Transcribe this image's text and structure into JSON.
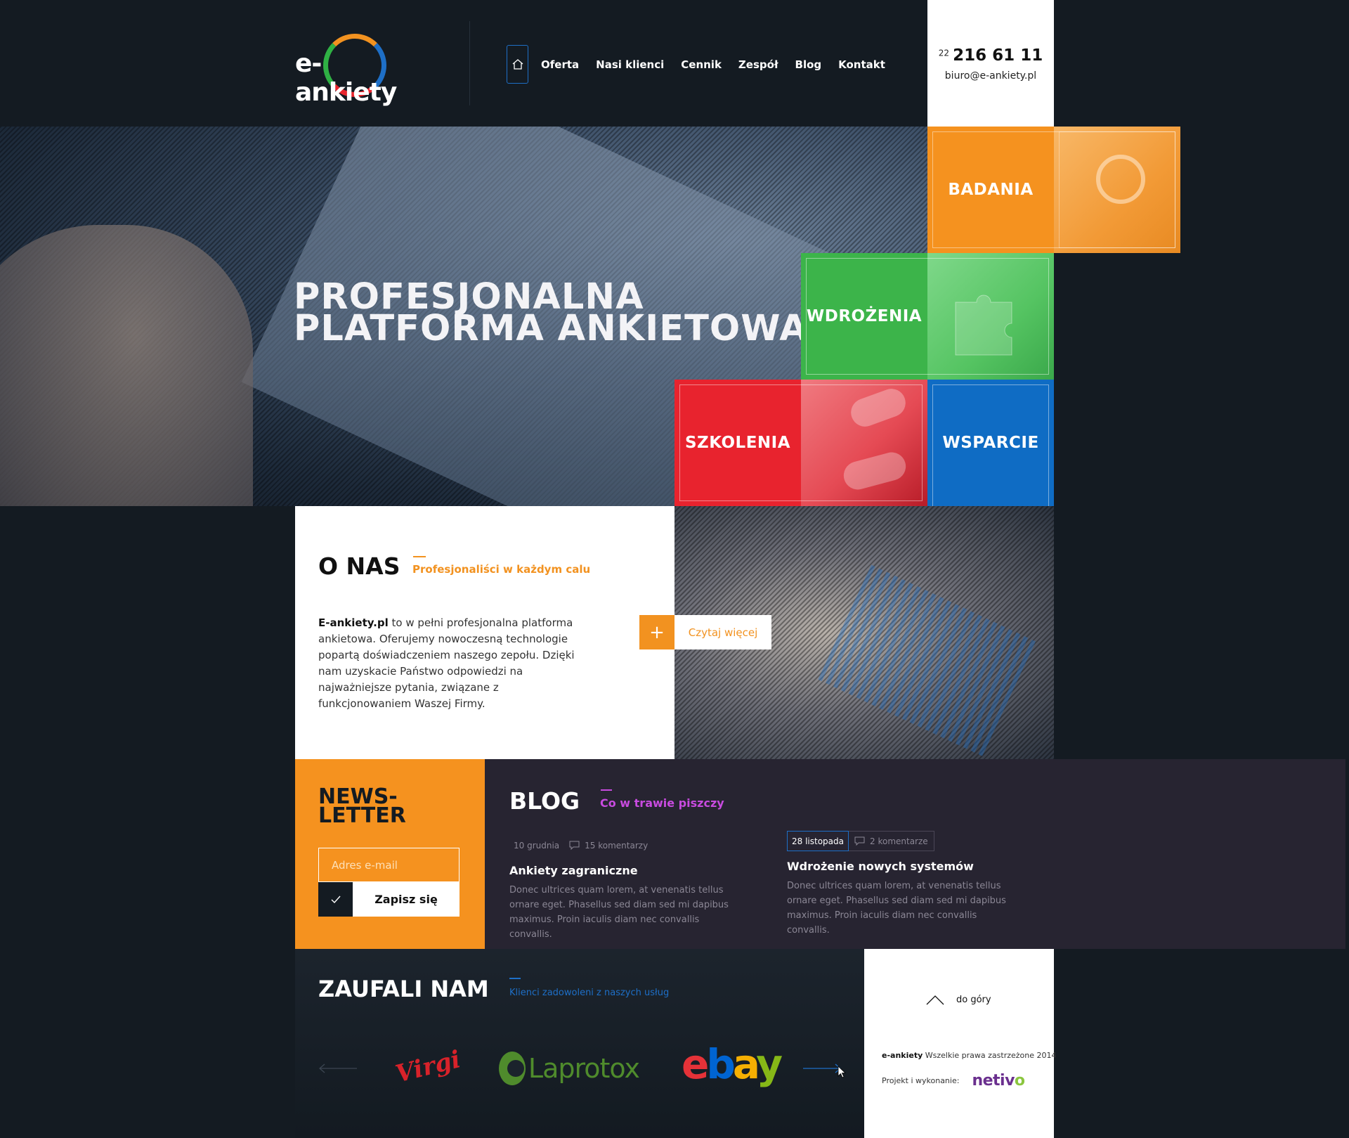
{
  "brand": {
    "name": "e-ankiety"
  },
  "nav": {
    "items": [
      {
        "label": "Oferta"
      },
      {
        "label": "Nasi klienci"
      },
      {
        "label": "Cennik"
      },
      {
        "label": "Zespół"
      },
      {
        "label": "Blog"
      },
      {
        "label": "Kontakt"
      }
    ]
  },
  "contact": {
    "prefix": "22",
    "phone": "216 61 11",
    "email": "biuro@e-ankiety.pl"
  },
  "hero": {
    "title_line1": "PROFESJONALNA",
    "title_line2": "PLATFORMA ANKIETOWA"
  },
  "tiles": {
    "badania": {
      "label": "BADANIA",
      "color": "#f5921f"
    },
    "wdrozenia": {
      "label": "WDROŻENIA",
      "color": "#3cb44a"
    },
    "szkolenia": {
      "label": "SZKOLENIA",
      "color": "#e8232e"
    },
    "wsparcie": {
      "label": "WSPARCIE",
      "color": "#0f6cc4"
    }
  },
  "about": {
    "title": "O NAS",
    "subtitle": "Profesjonaliści w każdym calu",
    "brand_bold": "E-ankiety.pl",
    "body": " to w pełni profesjonalna platforma ankietowa. Oferujemy nowoczesną technologie popartą doświadczeniem naszego zepołu. Dzięki nam uzyskacie Państwo odpowiedzi na najważniejsze pytania, związane z funkcjonowaniem Waszej Firmy.",
    "read_more": "Czytaj więcej",
    "read_more_icon": "+"
  },
  "newsletter": {
    "title_line1": "NEWS-",
    "title_line2": "LETTER",
    "placeholder": "Adres e-mail",
    "button": "Zapisz się"
  },
  "blog": {
    "title": "BLOG",
    "subtitle": "Co w trawie piszczy",
    "posts": [
      {
        "date": "10 grudnia",
        "comments": "15 komentarzy",
        "title": "Ankiety zagraniczne",
        "excerpt": "Donec ultrices quam lorem, at venenatis tellus ornare eget. Phasellus sed diam sed mi dapibus maximus. Proin iaculis diam nec convallis convallis."
      },
      {
        "date": "28 listopada",
        "comments": "2 komentarze",
        "title": "Wdrożenie nowych systemów",
        "excerpt": "Donec ultrices quam lorem, at venenatis tellus ornare eget. Phasellus sed diam sed mi dapibus maximus. Proin iaculis diam nec convallis convallis."
      }
    ]
  },
  "clients": {
    "title": "ZAUFALI NAM",
    "subtitle": "Klienci zadowoleni z naszych usług",
    "logos": {
      "virgin": "Virgin",
      "laprotox": "Laprotox",
      "ebay": [
        "e",
        "b",
        "a",
        "y"
      ]
    }
  },
  "footer": {
    "to_top": "do góry",
    "copy_brand": "e-ankiety",
    "copy_text": " Wszelkie prawa zastrzeżone 2014",
    "credit_label": "Projekt i wykonanie:",
    "credit_brand_a": "netiv",
    "credit_brand_b": "o"
  },
  "colors": {
    "orange": "#f5921f",
    "green": "#3cb44a",
    "red": "#e8232e",
    "blue": "#0f6cc4",
    "purple": "#c84bdf",
    "dark": "#141b22"
  }
}
